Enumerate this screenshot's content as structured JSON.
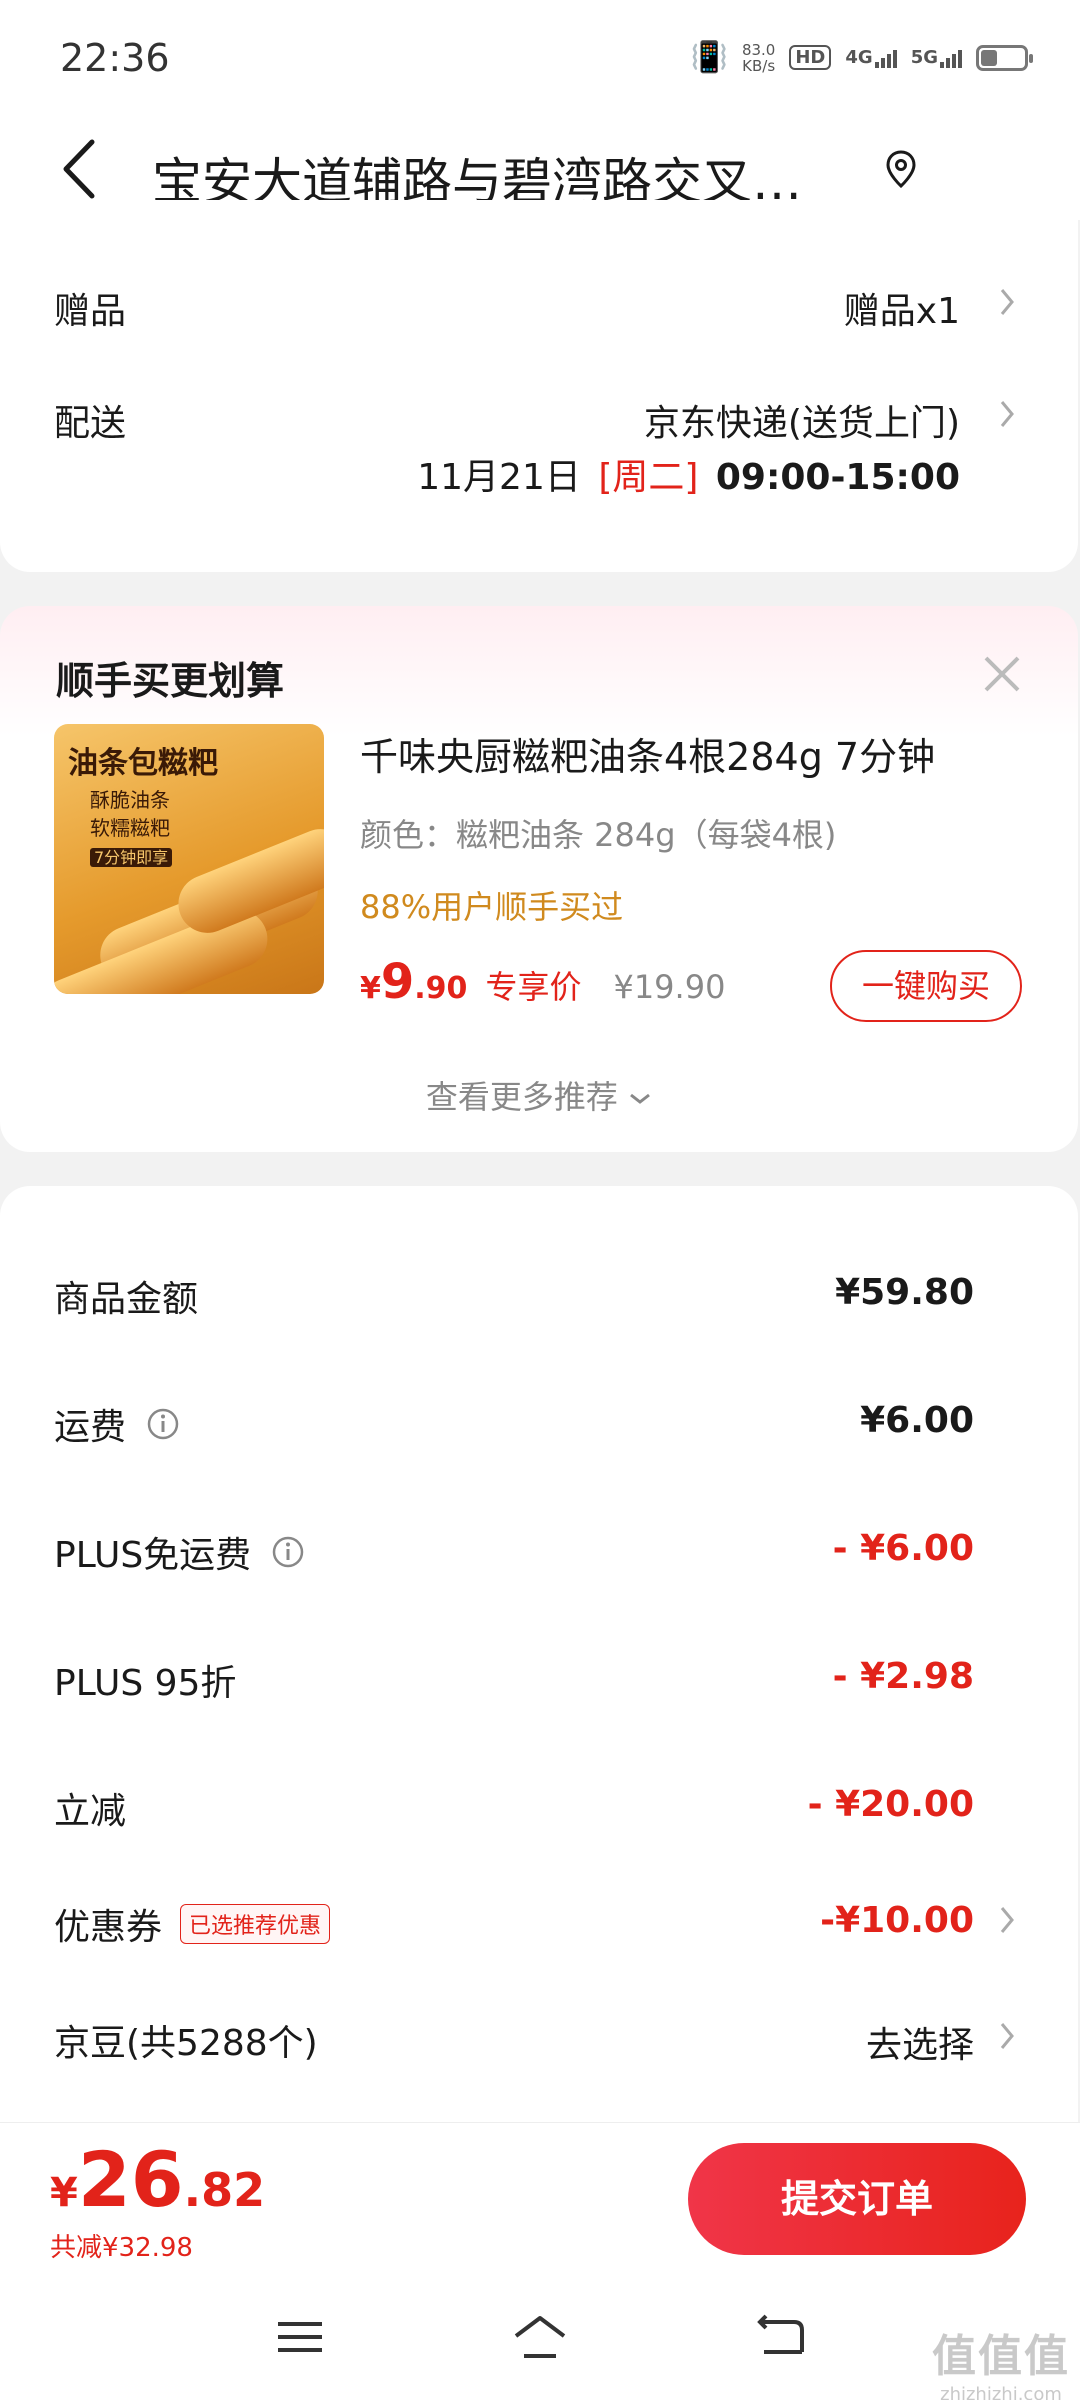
{
  "status_bar": {
    "time": "22:36",
    "speed_top": "83.0",
    "speed_unit": "KB/s",
    "hd": "HD",
    "net1": "4G",
    "net2": "5G"
  },
  "header": {
    "address": "宝安大道辅路与碧湾路交叉…",
    "back_icon": "chevron-left-icon",
    "location_icon": "location-pin-icon"
  },
  "delivery": {
    "gift_label": "赠品",
    "gift_value": "赠品x1",
    "ship_label": "配送",
    "ship_value": "京东快递(送货上门)",
    "date": "11月21日",
    "weekday": "[周二]",
    "time_range": "09:00-15:00"
  },
  "recommend": {
    "title": "顺手买更划算",
    "product": {
      "image_text_1": "油条包糍粑",
      "image_text_2": "酥脆油条",
      "image_text_3": "软糯糍粑",
      "image_text_4": "7分钟即享",
      "name": "千味央厨糍粑油条4根284g 7分钟",
      "spec": "颜色：糍粑油条 284g（每袋4根)",
      "bought": "88%用户顺手买过",
      "currency": "¥",
      "price_int": "9",
      "price_dec": ".90",
      "exclusive": "专享价",
      "original": "¥19.90",
      "buy_button": "一键购买"
    },
    "more": "查看更多推荐"
  },
  "summary": {
    "rows": [
      {
        "label": "商品金额",
        "value": "¥59.80"
      },
      {
        "label": "运费",
        "value": "¥6.00"
      },
      {
        "label": "PLUS免运费",
        "value": "- ¥6.00"
      },
      {
        "label": "PLUS 95折",
        "value": "- ¥2.98"
      },
      {
        "label": "立减",
        "value": "- ¥20.00"
      },
      {
        "label": "优惠券",
        "tag": "已选推荐优惠",
        "value": "-¥10.00"
      },
      {
        "label": "京豆(共5288个)",
        "value": "去选择"
      }
    ]
  },
  "bottom": {
    "currency": "¥",
    "total_int": "26",
    "total_dec": ".82",
    "saved": "共减¥32.98",
    "submit": "提交订单"
  },
  "watermark": {
    "logo": "值值值",
    "site": "zhizhizhi.com"
  },
  "colors": {
    "accent_red": "#e2231a",
    "bought_orange": "#d08a1e",
    "muted": "#888888"
  }
}
